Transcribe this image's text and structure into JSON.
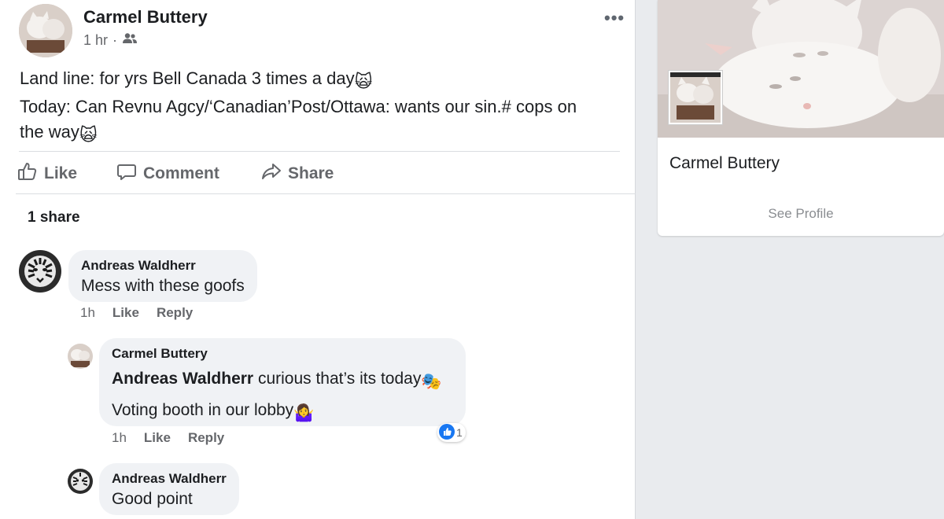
{
  "post": {
    "author": "Carmel Buttery",
    "time": "1 hr",
    "dot": "·",
    "menu": "•••",
    "text_line1": "Land line: for yrs Bell Canada 3 times a day",
    "text_line2": "Today: Can Revnu Agcy/‘Canadian’Post/Ottawa: wants our sin.# cops on",
    "text_line3": "the way",
    "emoji_scream_cat": "🙀",
    "actions": {
      "like": "Like",
      "comment": "Comment",
      "share": "Share"
    },
    "shares_count": "1 share"
  },
  "comments": [
    {
      "author": "Andreas Waldherr",
      "text": "Mess with these goofs",
      "time": "1h",
      "like": "Like",
      "reply": "Reply"
    },
    {
      "author": "Carmel Buttery",
      "mention": "Andreas Waldherr",
      "text_line1": " curious that’s its today",
      "emoji1": "🎭",
      "text_line2": "Voting booth in our lobby",
      "emoji2": "🤷‍♀️",
      "time": "1h",
      "like": "Like",
      "reply": "Reply",
      "reaction_count": "1"
    },
    {
      "author": "Andreas Waldherr",
      "text": "Good point"
    }
  ],
  "profile_card": {
    "name": "Carmel Buttery",
    "see_profile": "See Profile"
  },
  "colors": {
    "accent_blue": "#1877f2",
    "secondary_text": "#65676b",
    "bubble_bg": "#f0f2f5",
    "page_bg": "#e9ebee"
  }
}
